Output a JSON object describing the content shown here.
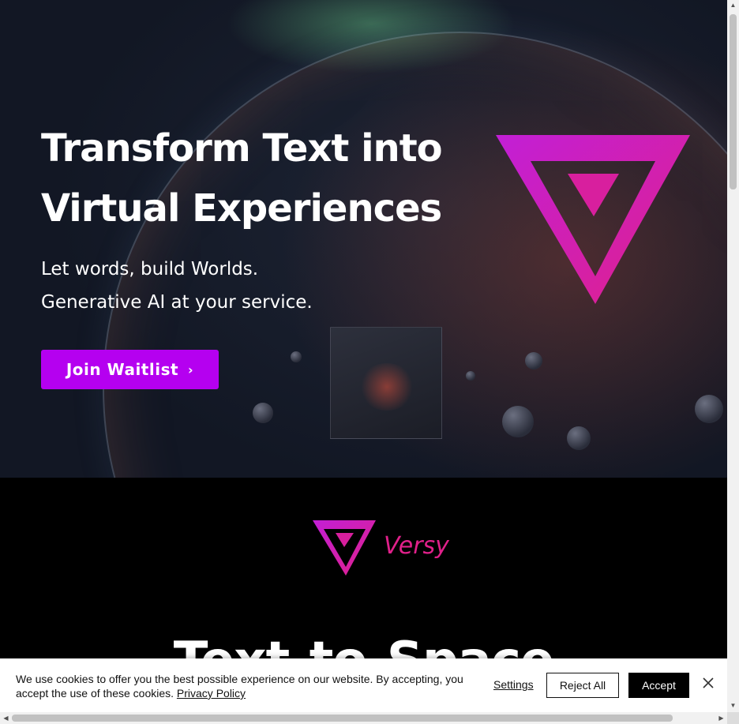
{
  "hero": {
    "title": "Transform Text into Virtual Experiences",
    "subtitle_line1": "Let words, build Worlds.",
    "subtitle_line2": "Generative AI at your service.",
    "cta_label": "Join Waitlist",
    "cta_icon": "chevron-right-icon"
  },
  "brand": {
    "name": "Versy",
    "logo_icon": "versy-v-logo"
  },
  "section": {
    "title": "Text-to-Space"
  },
  "cookie_banner": {
    "message": "We use cookies to offer you the best possible experience on our website. By accepting, you accept the use of these cookies.",
    "privacy_link": "Privacy Policy",
    "settings_label": "Settings",
    "reject_label": "Reject All",
    "accept_label": "Accept",
    "close_icon": "close-icon"
  },
  "colors": {
    "accent": "#b500f0",
    "logo_gradient_start": "#c21fd6",
    "logo_gradient_end": "#e0208a"
  }
}
